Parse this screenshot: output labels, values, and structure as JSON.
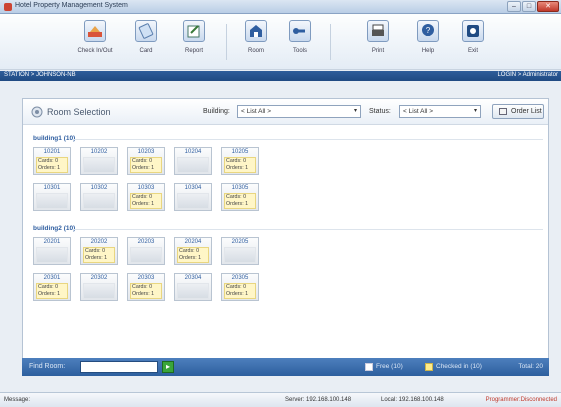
{
  "window": {
    "title": "Hotel Property Management System",
    "min": "–",
    "max": "□",
    "close": "✕"
  },
  "toolbar": {
    "items": [
      {
        "label": "Check In/Out",
        "icon": "check-in-out-icon"
      },
      {
        "label": "Card",
        "icon": "card-icon"
      },
      {
        "label": "Report",
        "icon": "report-icon"
      },
      {
        "label": "Room",
        "icon": "room-icon"
      },
      {
        "label": "Tools",
        "icon": "tools-icon"
      },
      {
        "label": "Print",
        "icon": "printer-icon"
      },
      {
        "label": "Help",
        "icon": "help-icon"
      },
      {
        "label": "Exit",
        "icon": "exit-icon"
      }
    ]
  },
  "station": {
    "path": "STATION > JOHNSON-NB",
    "login": "LOGIN > Administrator"
  },
  "room_selection": {
    "title": "Room Selection",
    "building_label": "Building:",
    "building_value": "< List All >",
    "status_label": "Status:",
    "status_value": "< List All >",
    "order_list_label": "Order List"
  },
  "groups": [
    {
      "title": "building1 (10)",
      "rooms": [
        {
          "number": "10201",
          "cards": "Cards: 0",
          "orders": "Orders: 1",
          "status": "checked"
        },
        {
          "number": "10202",
          "status": "free"
        },
        {
          "number": "10203",
          "cards": "Cards: 0",
          "orders": "Orders: 1",
          "status": "checked"
        },
        {
          "number": "10204",
          "status": "free"
        },
        {
          "number": "10205",
          "cards": "Cards: 0",
          "orders": "Orders: 1",
          "status": "checked"
        },
        {
          "number": "10301",
          "status": "free"
        },
        {
          "number": "10302",
          "status": "free"
        },
        {
          "number": "10303",
          "cards": "Cards: 0",
          "orders": "Orders: 1",
          "status": "checked"
        },
        {
          "number": "10304",
          "status": "free"
        },
        {
          "number": "10305",
          "cards": "Cards: 0",
          "orders": "Orders: 1",
          "status": "checked"
        }
      ]
    },
    {
      "title": "building2 (10)",
      "rooms": [
        {
          "number": "20201",
          "status": "free"
        },
        {
          "number": "20202",
          "cards": "Cards: 0",
          "orders": "Orders: 1",
          "status": "checked"
        },
        {
          "number": "20203",
          "status": "free"
        },
        {
          "number": "20204",
          "cards": "Cards: 0",
          "orders": "Orders: 1",
          "status": "checked"
        },
        {
          "number": "20205",
          "status": "free"
        },
        {
          "number": "20301",
          "cards": "Cards: 0",
          "orders": "Orders: 1",
          "status": "checked"
        },
        {
          "number": "20302",
          "status": "free"
        },
        {
          "number": "20303",
          "cards": "Cards: 0",
          "orders": "Orders: 1",
          "status": "checked"
        },
        {
          "number": "20304",
          "status": "free"
        },
        {
          "number": "20305",
          "cards": "Cards: 0",
          "orders": "Orders: 1",
          "status": "checked"
        }
      ]
    }
  ],
  "footer": {
    "find_room_label": "Find Room:",
    "find_room_value": "",
    "go_symbol": "▸",
    "free_label": "Free (10)",
    "checked_label": "Checked in (10)",
    "total_label": "Total: 20"
  },
  "statusbar": {
    "message": "Message:",
    "server": "Server: 192.168.100.148",
    "local": "Local: 192.168.100.148",
    "programmer": "Programmer:Disconnected"
  },
  "colors": {
    "accent": "#2d5f9e",
    "room_number": "#2f5ea0",
    "checked_bg": "#fff6c7",
    "free_bg": "#e3e7ec",
    "disconnected": "#c0392b"
  }
}
